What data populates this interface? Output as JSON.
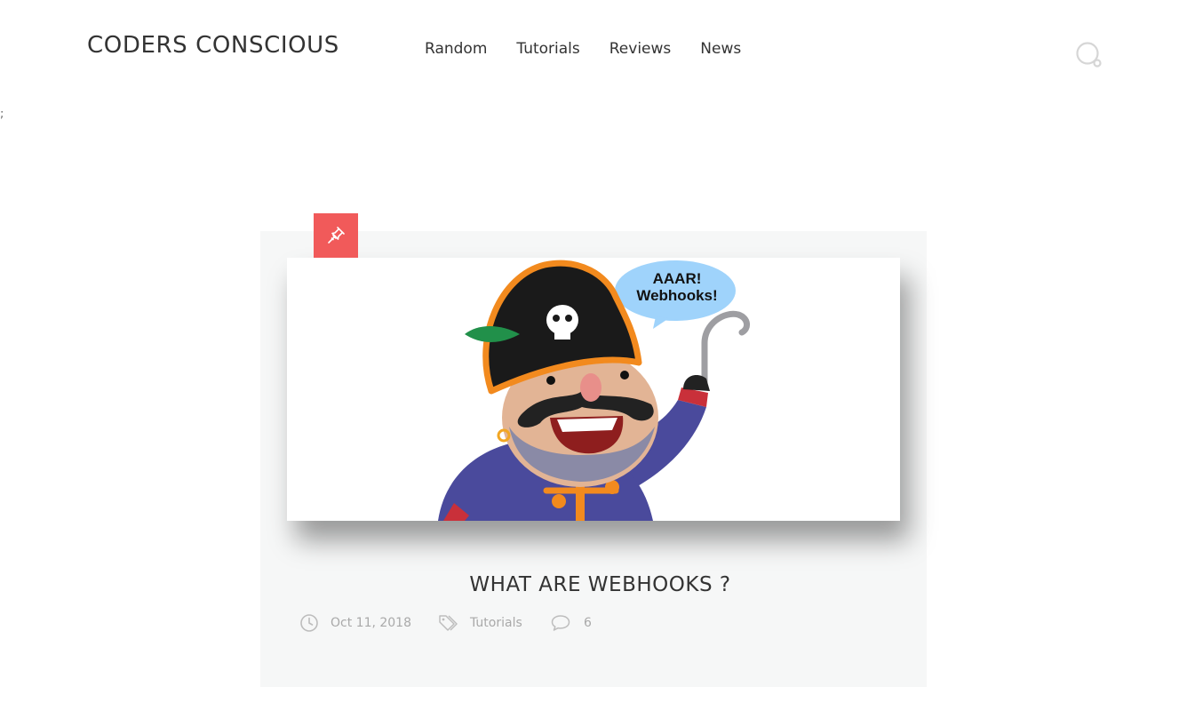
{
  "site": {
    "title": "CODERS CONSCIOUS"
  },
  "nav": {
    "items": [
      {
        "label": "Random"
      },
      {
        "label": "Tutorials"
      },
      {
        "label": "Reviews"
      },
      {
        "label": "News"
      }
    ]
  },
  "header": {
    "search_icon": "search-icon"
  },
  "page": {
    "stray_text": ";"
  },
  "post": {
    "badge_icon": "pushpin-icon",
    "image_bubble_text": [
      "AAAR!",
      "Webhooks!"
    ],
    "title": "WHAT ARE WEBHOOKS ?",
    "date": "Oct 11, 2018",
    "category": "Tutorials",
    "comments": "6"
  },
  "colors": {
    "accent": "#f15a5a",
    "card_bg": "#f6f7f7",
    "meta_text": "#a9a9a9"
  }
}
